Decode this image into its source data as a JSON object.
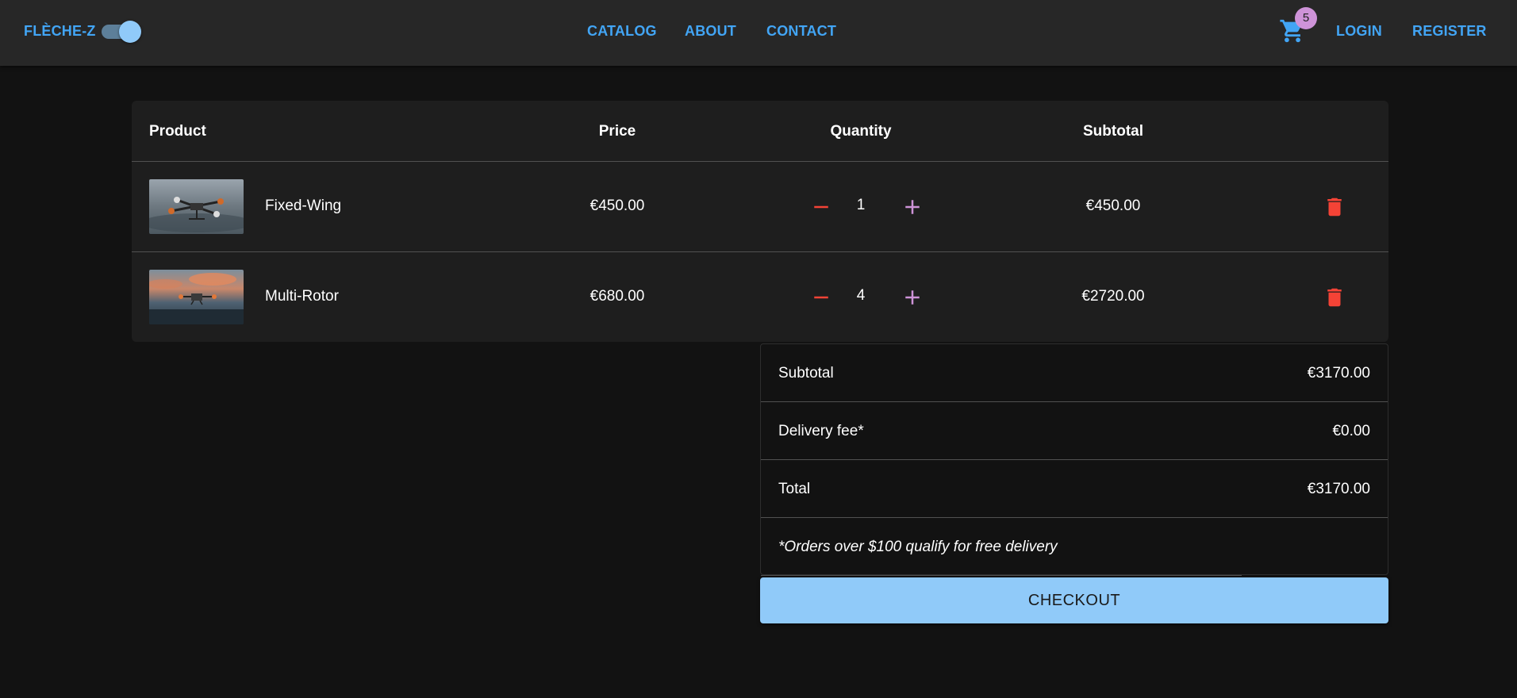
{
  "header": {
    "brand": "FLÈCHE-Z",
    "theme_toggle_on": true,
    "nav": [
      {
        "label": "CATALOG"
      },
      {
        "label": "ABOUT"
      },
      {
        "label": "CONTACT"
      }
    ],
    "cart_count": "5",
    "cart_icon": "shopping-cart-icon",
    "login_label": "LOGIN",
    "register_label": "REGISTER"
  },
  "cart_table": {
    "headers": {
      "product": "Product",
      "price": "Price",
      "quantity": "Quantity",
      "subtotal": "Subtotal"
    },
    "rows": [
      {
        "name": "Fixed-Wing",
        "price": "€450.00",
        "quantity": "1",
        "subtotal": "€450.00"
      },
      {
        "name": "Multi-Rotor",
        "price": "€680.00",
        "quantity": "4",
        "subtotal": "€2720.00"
      }
    ]
  },
  "summary": {
    "subtotal_label": "Subtotal",
    "subtotal_value": "€3170.00",
    "delivery_label": "Delivery fee*",
    "delivery_value": "€0.00",
    "total_label": "Total",
    "total_value": "€3170.00",
    "note": "*Orders over $100 qualify for free delivery"
  },
  "checkout_label": "CHECKOUT",
  "colors": {
    "accent": "#42a5f5",
    "button": "#90caf9",
    "badge": "#ce93d8",
    "remove": "#f44336",
    "add": "#ce93d8"
  }
}
